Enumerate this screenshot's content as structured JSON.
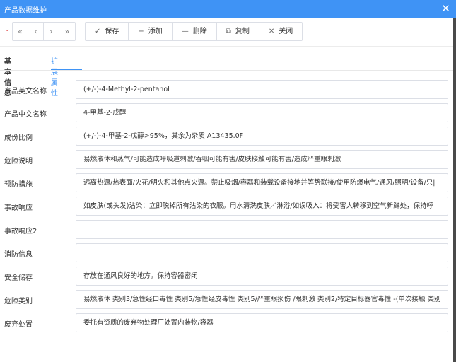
{
  "window": {
    "title": "产品数据维护",
    "close_icon": "close-icon",
    "accent_color": "#3f93f5"
  },
  "toolbar": {
    "collapse_icon": "chevron-down-icon",
    "nav": [
      {
        "name": "first-button",
        "glyph": "«"
      },
      {
        "name": "prev-button",
        "glyph": "‹"
      },
      {
        "name": "next-button",
        "glyph": "›"
      },
      {
        "name": "last-button",
        "glyph": "»"
      }
    ],
    "actions": [
      {
        "name": "save-button",
        "icon": "check-icon",
        "glyph": "✓",
        "label": "保存"
      },
      {
        "name": "add-button",
        "icon": "plus-icon",
        "glyph": "+",
        "label": "添加"
      },
      {
        "name": "delete-button",
        "icon": "minus-icon",
        "glyph": "—",
        "label": "删除"
      },
      {
        "name": "copy-button",
        "icon": "copy-icon",
        "glyph": "⧉",
        "label": "复制"
      },
      {
        "name": "close-button",
        "icon": "x-icon",
        "glyph": "✕",
        "label": "关闭"
      }
    ]
  },
  "tabs": [
    {
      "label": "基本信息",
      "active": false
    },
    {
      "label": "扩展属性",
      "active": true
    }
  ],
  "fields": [
    {
      "label": "产品英文名称",
      "value": "(+/-)-4-Methyl-2-pentanol"
    },
    {
      "label": "产品中文名称",
      "value": "4-甲基-2-戊醇"
    },
    {
      "label": "成份比例",
      "value": "(+/-)-4-甲基-2-戊醇>95%，其余为杂质 A13435.0F"
    },
    {
      "label": "危险说明",
      "value": "易燃液体和蒸气/可能造成呼吸道刺激/吞咽可能有害/皮肤接触可能有害/造成严重眼刺激"
    },
    {
      "label": "预防措施",
      "value": "远离热源/热表面/火花/明火和其他点火源。禁止吸烟/容器和装载设备接地并等势联接/使用防爆电气/通风/照明/设备/只|"
    },
    {
      "label": "事故响应",
      "value": "如皮肤(或头发)沾染：立即脱掉所有沾染的衣服。用水清洗皮肤／淋浴/如误吸入：将受害人转移到空气新鲜处，保持呼"
    },
    {
      "label": "事故响应2",
      "value": ""
    },
    {
      "label": "消防信息",
      "value": ""
    },
    {
      "label": "安全储存",
      "value": "存放在通风良好的地方。保持容器密闭"
    },
    {
      "label": "危险类别",
      "value": "易燃液体 类别3/急性经口毒性 类别5/急性经皮毒性 类别5/严重眼损伤 /眼刺激 类别2/特定目标器官毒性 -(单次接触 类别"
    },
    {
      "label": "废弃处置",
      "value": "委托有资质的废弃物处理厂处置内装物/容器"
    }
  ]
}
